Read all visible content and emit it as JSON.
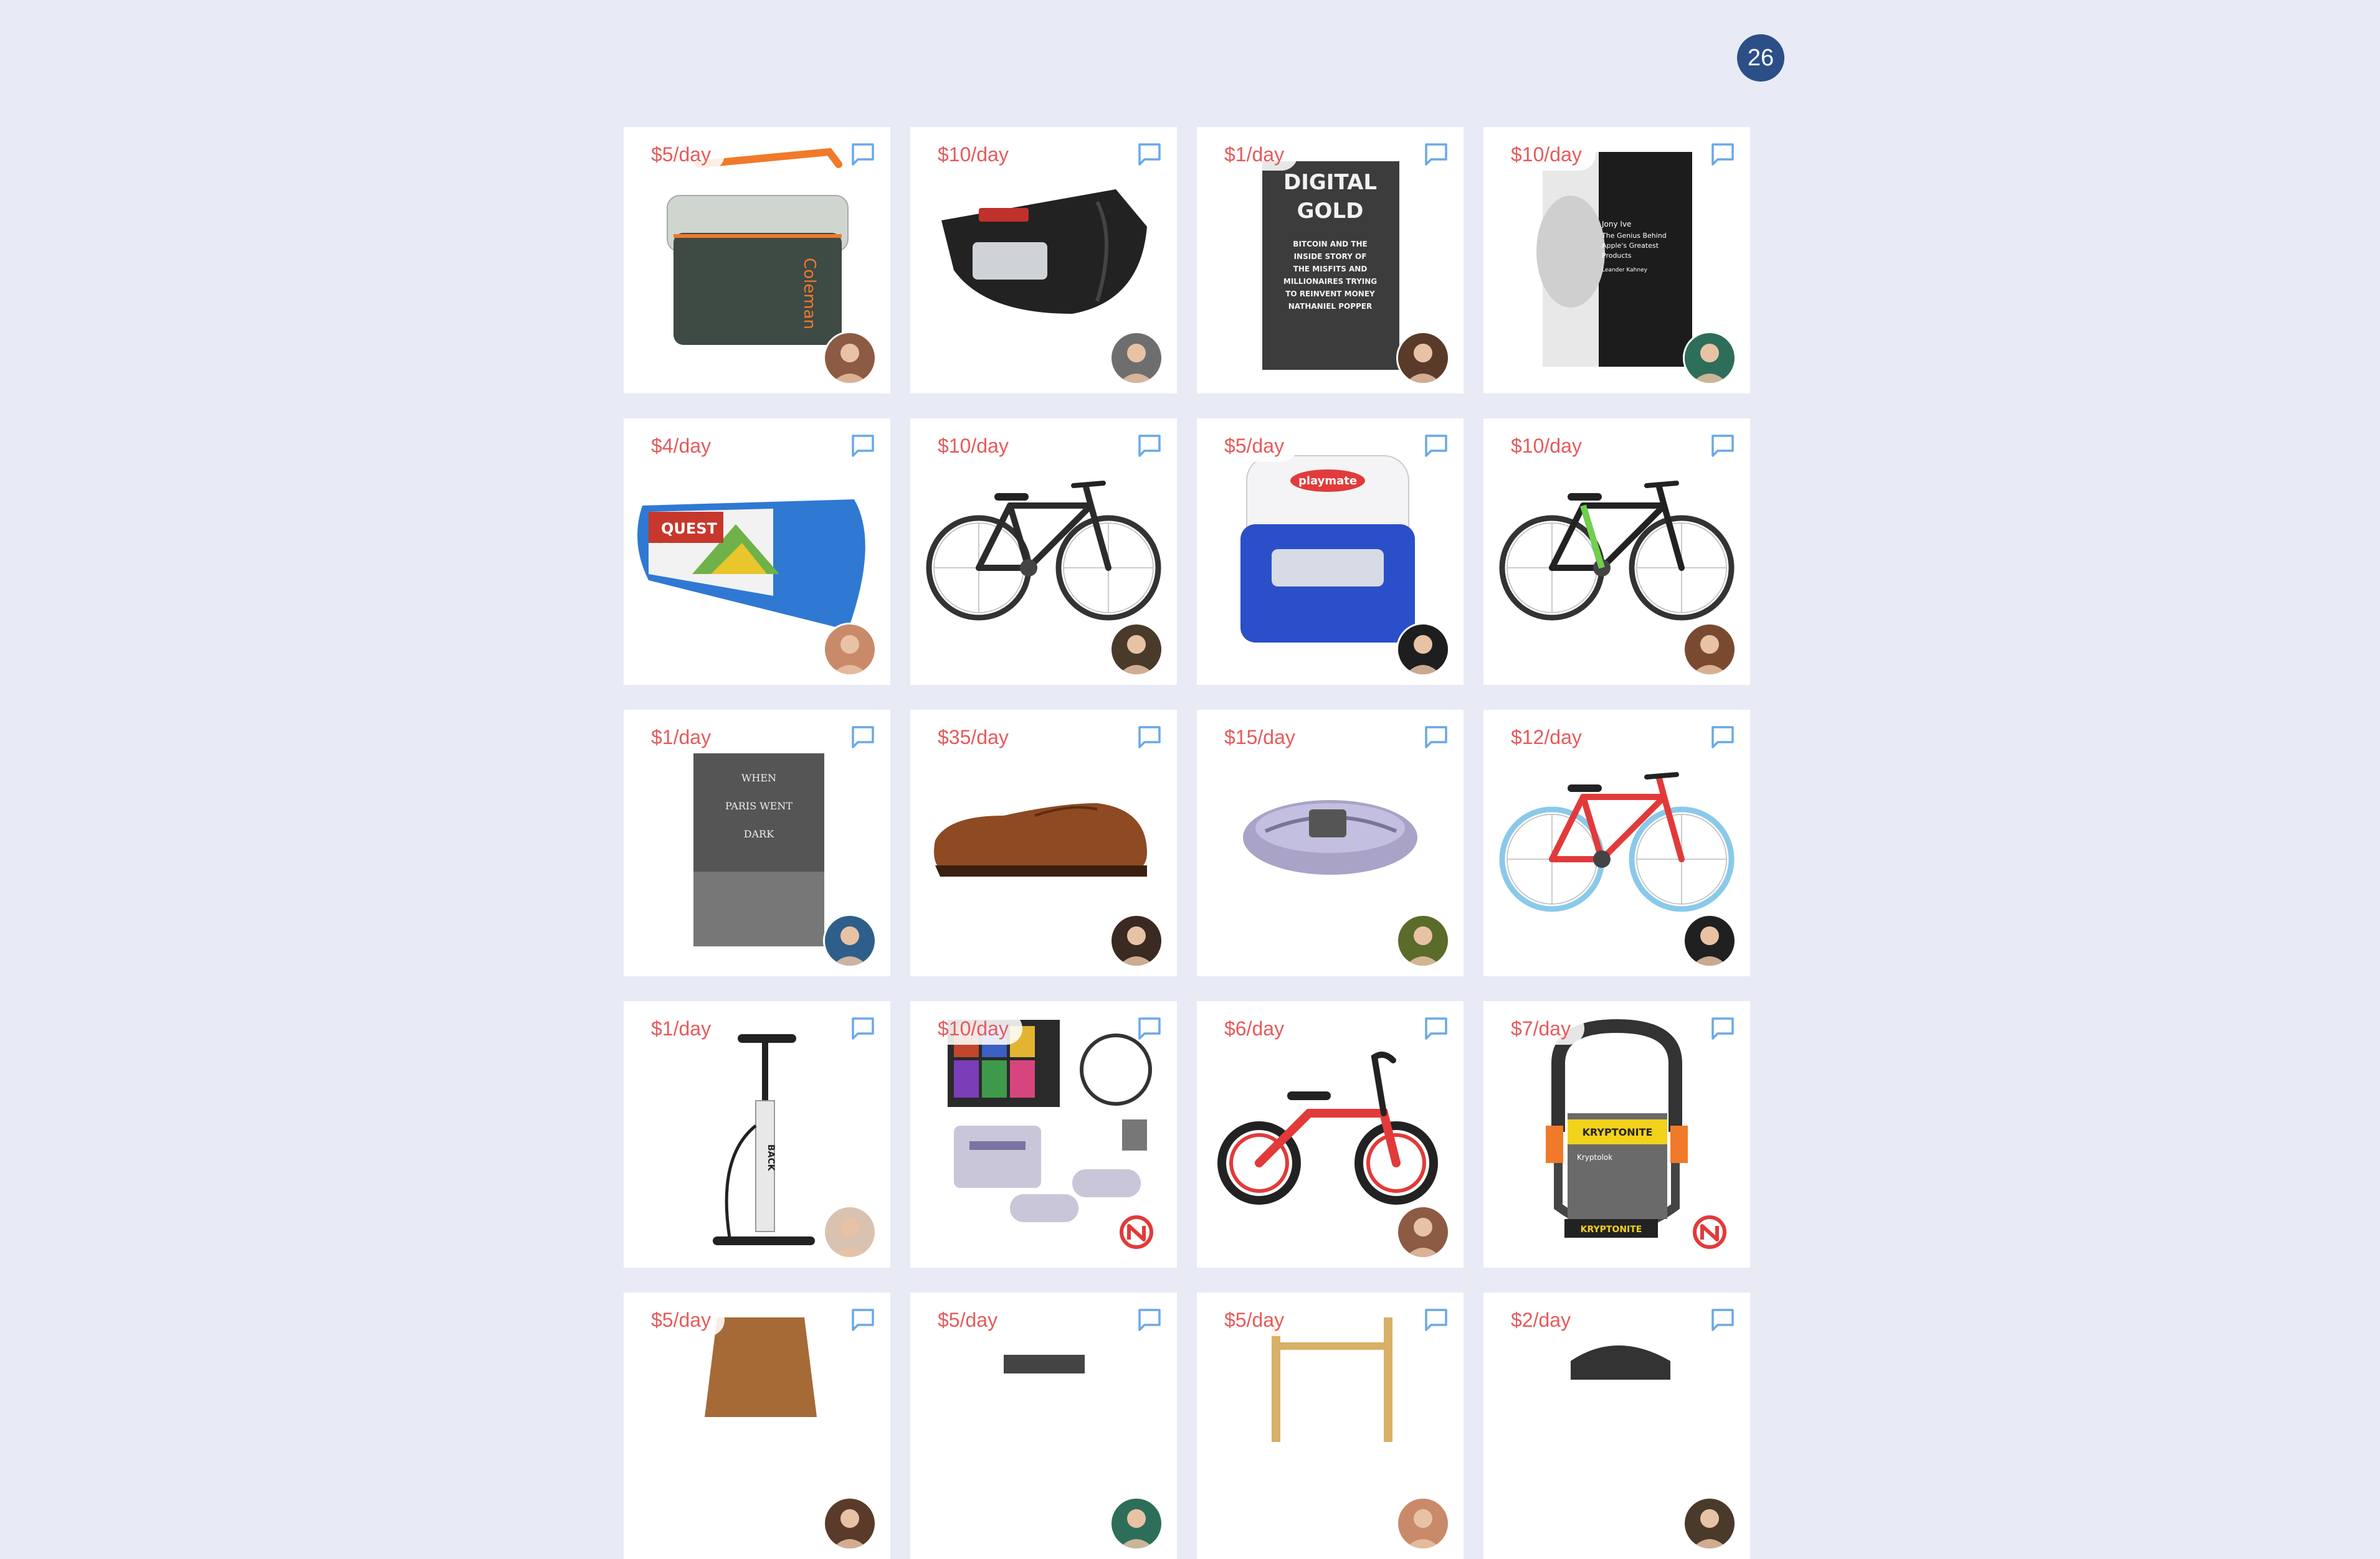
{
  "badge": {
    "count": "26"
  },
  "colors": {
    "background": "#e8ebf6",
    "price_text": "#e65a5a",
    "comment_icon": "#6aa8e8",
    "badge_bg": "#2b4f86"
  },
  "items": [
    {
      "price": "$5/day",
      "product_icon": "cooler-icon",
      "cover_lines": [
        "Coleman"
      ],
      "avatar_icon": "user-avatar-icon"
    },
    {
      "price": "$10/day",
      "product_icon": "saddle-bag-icon",
      "cover_lines": [],
      "avatar_icon": "user-avatar-icon"
    },
    {
      "price": "$1/day",
      "product_icon": "book-icon",
      "cover_lines": [
        "DIGITAL",
        "GOLD",
        "BITCOIN AND THE",
        "INSIDE STORY OF",
        "THE MISFITS AND",
        "MILLIONAIRES TRYING",
        "TO REINVENT MONEY",
        "NATHANIEL POPPER"
      ],
      "avatar_icon": "user-avatar-icon"
    },
    {
      "price": "$10/day",
      "product_icon": "book-icon",
      "cover_lines": [
        "Jony Ive",
        "The Genius Behind",
        "Apple's Greatest",
        "Products",
        "Leander Kahney"
      ],
      "avatar_icon": "user-avatar-icon"
    },
    {
      "price": "$4/day",
      "product_icon": "tent-bag-icon",
      "cover_lines": [
        "QUEST"
      ],
      "avatar_icon": "user-avatar-icon"
    },
    {
      "price": "$10/day",
      "product_icon": "bicycle-icon",
      "cover_lines": [],
      "avatar_icon": "user-avatar-icon"
    },
    {
      "price": "$5/day",
      "product_icon": "cooler-icon",
      "cover_lines": [
        "playmate"
      ],
      "avatar_icon": "user-avatar-icon"
    },
    {
      "price": "$10/day",
      "product_icon": "bicycle-icon",
      "cover_lines": [],
      "avatar_icon": "user-avatar-icon"
    },
    {
      "price": "$1/day",
      "product_icon": "book-icon",
      "cover_lines": [
        "WHEN",
        "PARIS WENT",
        "DARK"
      ],
      "avatar_icon": "user-avatar-icon"
    },
    {
      "price": "$35/day",
      "product_icon": "shoe-icon",
      "cover_lines": [],
      "avatar_icon": "user-avatar-icon"
    },
    {
      "price": "$15/day",
      "product_icon": "tent-bag-icon",
      "cover_lines": [],
      "avatar_icon": "user-avatar-icon"
    },
    {
      "price": "$12/day",
      "product_icon": "bicycle-icon",
      "cover_lines": [],
      "avatar_icon": "user-avatar-icon"
    },
    {
      "price": "$1/day",
      "product_icon": "bike-pump-icon",
      "cover_lines": [
        "BACK"
      ],
      "avatar_icon": "user-avatar-icon"
    },
    {
      "price": "$10/day",
      "product_icon": "game-console-icon",
      "cover_lines": [],
      "avatar_icon": "brand-logo-icon"
    },
    {
      "price": "$6/day",
      "product_icon": "balance-bike-icon",
      "cover_lines": [],
      "avatar_icon": "user-avatar-icon"
    },
    {
      "price": "$7/day",
      "product_icon": "bike-lock-icon",
      "cover_lines": [
        "KRYPTONITE",
        "Kryptolok",
        "KRYPTONITE"
      ],
      "avatar_icon": "brand-logo-icon"
    },
    {
      "price": "$5/day",
      "product_icon": "basket-icon",
      "cover_lines": [],
      "avatar_icon": "user-avatar-icon"
    },
    {
      "price": "$5/day",
      "product_icon": "item-icon",
      "cover_lines": [],
      "avatar_icon": "user-avatar-icon"
    },
    {
      "price": "$5/day",
      "product_icon": "shelf-icon",
      "cover_lines": [],
      "avatar_icon": "user-avatar-icon"
    },
    {
      "price": "$2/day",
      "product_icon": "helmet-icon",
      "cover_lines": [],
      "avatar_icon": "user-avatar-icon"
    }
  ]
}
